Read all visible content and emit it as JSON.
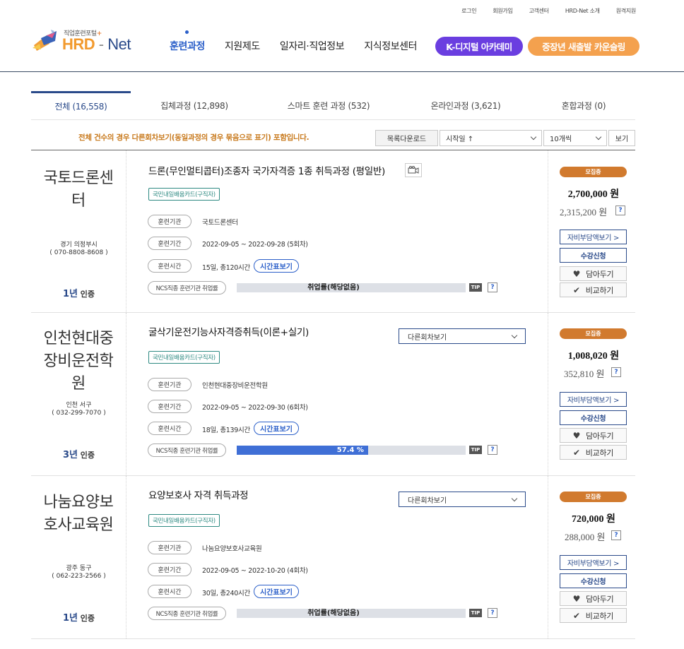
{
  "util_links": [
    "로그인",
    "회원가입",
    "고객센터",
    "HRD-Net 소개",
    "원격지원"
  ],
  "logo": {
    "sub": "직업훈련포털",
    "plus": "+",
    "hrd": "HRD",
    "dash": "-",
    "net": "Net"
  },
  "gnb": [
    "훈련과정",
    "지원제도",
    "일자리·직업정보",
    "지식정보센터"
  ],
  "kdigital": "K-디지털 아카데미",
  "counsel": "중장년 새출발 카운슬링",
  "tabs": [
    "전체 (16,558)",
    "집체과정 (12,898)",
    "스마트 훈련 과정 (532)",
    "온라인과정 (3,621)",
    "혼합과정 (0)"
  ],
  "notice": "전체 건수의 경우 다른회차보기(동일과정의 경우 묶음으로 표기) 포함입니다.",
  "controls": {
    "download": "목록다운로드",
    "sort": "시작일 ↑",
    "count": "10개씩",
    "view": "보기"
  },
  "labels": {
    "org": "훈련기관",
    "period": "훈련기간",
    "hours": "훈련시간",
    "ncs": "NCS직종 훈련기관 취업률",
    "timetable": "시간표보기",
    "tip": "TIP",
    "q": "?",
    "other": "다른회차보기",
    "cost_view": "자비부담액보기 >",
    "apply": "수강신청",
    "wish": "담아두기",
    "compare": "비교하기",
    "cert": "인증"
  },
  "courses": [
    {
      "inst_lines": [
        "국토드론센",
        "터"
      ],
      "addr": "경기 의정부시",
      "tel": "( 070-8808-8608 )",
      "cert_years": "1년",
      "title": "드론(무인멀티콥터)조종자 국가자격증 1종 취득과정 (평일반)",
      "card": "국민내일배움카드(구직자)",
      "org": "국토드론센터",
      "period": "2022-09-05 ~ 2022-09-28 (5회차)",
      "hours": "15일, 총120시간",
      "rate_label": "취업률(해당없음)",
      "rate": null,
      "badge": "모집중",
      "price": "2,700,000 원",
      "price2": "2,315,200 원"
    },
    {
      "inst_lines": [
        "인천현대중",
        "장비운전학",
        "원"
      ],
      "addr": "인천 서구",
      "tel": "( 032-299-7070 )",
      "cert_years": "3년",
      "title": "굴삭기운전기능사자격증취득(이론+실기)",
      "card": "국민내일배움카드(구직자)",
      "org": "인천현대중장비운전학원",
      "period": "2022-09-05 ~ 2022-09-30 (6회차)",
      "hours": "18일, 총139시간",
      "rate_label": "57.4 %",
      "rate": 57.4,
      "badge": "모집중",
      "price": "1,008,020 원",
      "price2": "352,810 원"
    },
    {
      "inst_lines": [
        "나눔요양보",
        "호사교육원"
      ],
      "addr": "광주 동구",
      "tel": "( 062-223-2566 )",
      "cert_years": "1년",
      "title": "요양보호사 자격 취득과정",
      "card": "국민내일배움카드(구직자)",
      "org": "나눔요양보호사교육원",
      "period": "2022-09-05 ~ 2022-10-20 (4회차)",
      "hours": "30일, 총240시간",
      "rate_label": "취업률(해당없음)",
      "rate": null,
      "badge": "모집중",
      "price": "720,000 원",
      "price2": "288,000 원"
    }
  ]
}
